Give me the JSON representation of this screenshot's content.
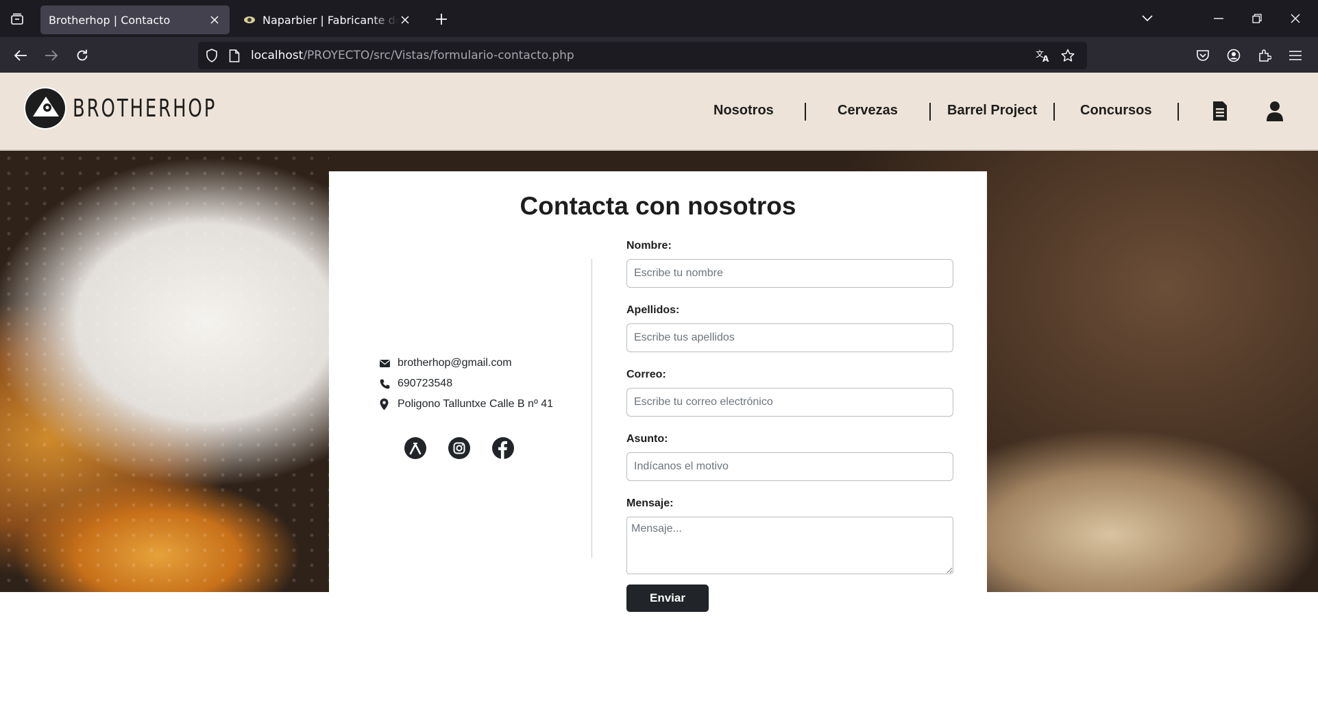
{
  "browser": {
    "tabs": [
      {
        "title": "Brotherhop | Contacto",
        "active": true
      },
      {
        "title": "Naparbier | Fabricante de cerveza",
        "active": false
      }
    ],
    "url_host": "localhost",
    "url_path": "/PROYECTO/src/Vistas/formulario-contacto.php"
  },
  "header": {
    "logo_text": "BROTHERHOP",
    "menu": [
      "Nosotros",
      "Cervezas",
      "Barrel Project",
      "Concursos"
    ]
  },
  "contact": {
    "title": "Contacta con nosotros",
    "email": "brotherhop@gmail.com",
    "phone": "690723548",
    "address": "Poligono Talluntxe Calle B nº 41"
  },
  "form": {
    "nombre_label": "Nombre:",
    "nombre_placeholder": "Escribe tu nombre",
    "apellidos_label": "Apellidos:",
    "apellidos_placeholder": "Escribe tus apellidos",
    "correo_label": "Correo:",
    "correo_placeholder": "Escribe tu correo electrónico",
    "asunto_label": "Asunto:",
    "asunto_placeholder": "Indícanos el motivo",
    "mensaje_label": "Mensaje:",
    "mensaje_placeholder": "Mensaje...",
    "submit_label": "Enviar"
  },
  "colors": {
    "header_bg": "#ede3d8",
    "text_dark": "#1d1d1d",
    "button_bg": "#212529",
    "browser_dark": "#1c1b22"
  }
}
